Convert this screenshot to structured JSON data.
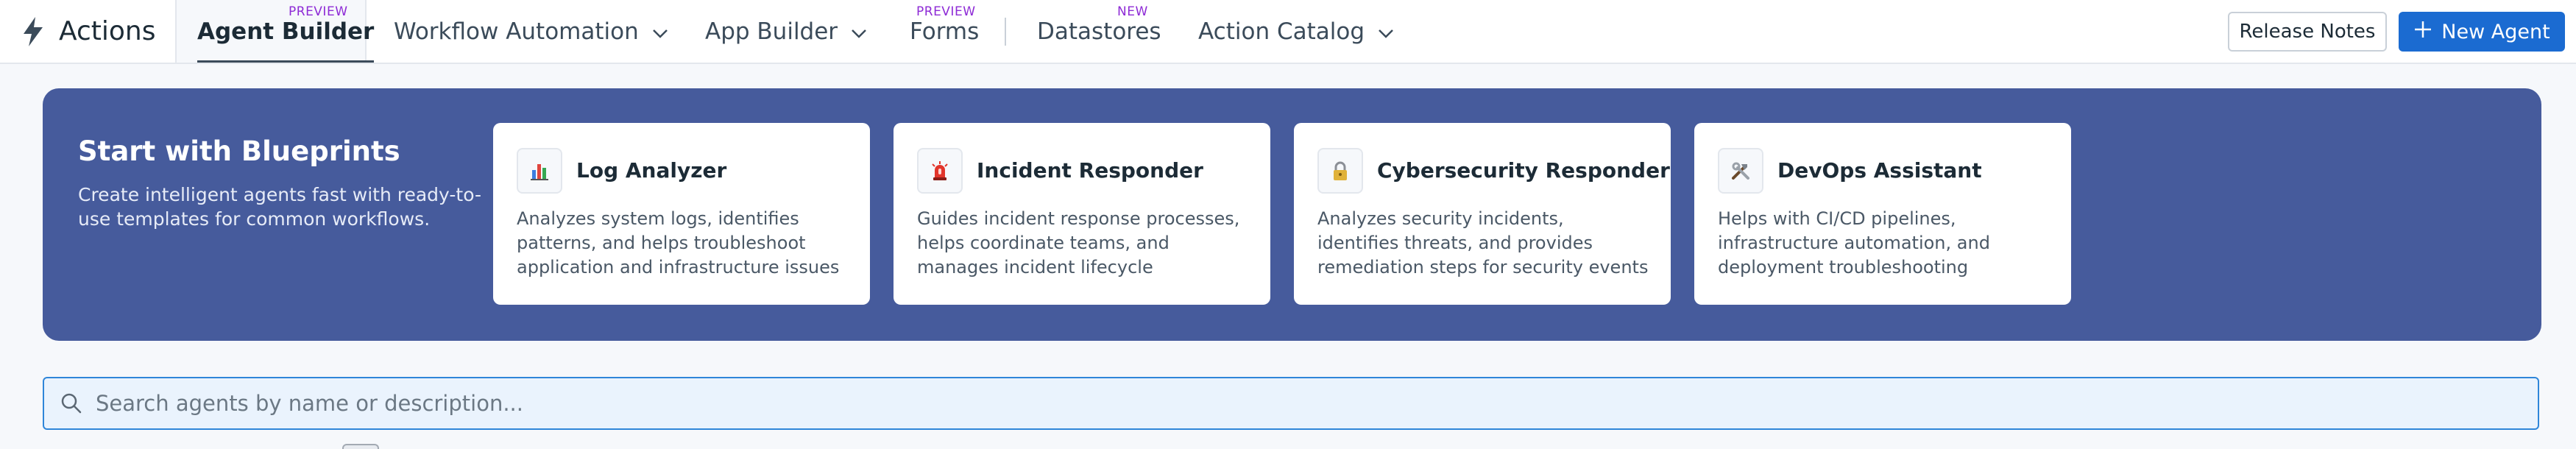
{
  "app": {
    "title": "Actions"
  },
  "nav": {
    "items": [
      {
        "label": "Agent Builder",
        "badge": "PREVIEW",
        "active": true
      },
      {
        "label": "Workflow Automation",
        "dropdown": true
      },
      {
        "label": "App Builder",
        "dropdown": true
      },
      {
        "label": "Forms",
        "badge": "PREVIEW"
      },
      {
        "label": "Datastores",
        "badge": "NEW"
      },
      {
        "label": "Action Catalog",
        "dropdown": true
      }
    ]
  },
  "header_buttons": {
    "release_notes": "Release Notes",
    "new_agent": "New Agent"
  },
  "blueprints": {
    "title": "Start with Blueprints",
    "description": "Create intelligent agents fast with ready-to-use templates for common workflows.",
    "cards": [
      {
        "title": "Log Analyzer",
        "description": "Analyzes system logs, identifies patterns, and helps troubleshoot application and infrastructure issues",
        "icon": "bar-chart-icon"
      },
      {
        "title": "Incident Responder",
        "description": "Guides incident response processes, helps coordinate teams, and manages incident lifecycle",
        "icon": "siren-icon"
      },
      {
        "title": "Cybersecurity Responder",
        "description": "Analyzes security incidents, identifies threats, and provides remediation steps for security events",
        "icon": "lock-icon"
      },
      {
        "title": "DevOps Assistant",
        "description": "Helps with CI/CD pipelines, infrastructure automation, and deployment troubleshooting",
        "icon": "tools-icon"
      }
    ]
  },
  "search": {
    "placeholder": "Search agents by name or description..."
  },
  "colors": {
    "banner": "#465b9c",
    "primary": "#1b6bd1",
    "badge": "#8e2bd6",
    "search_border": "#2f86d9"
  }
}
